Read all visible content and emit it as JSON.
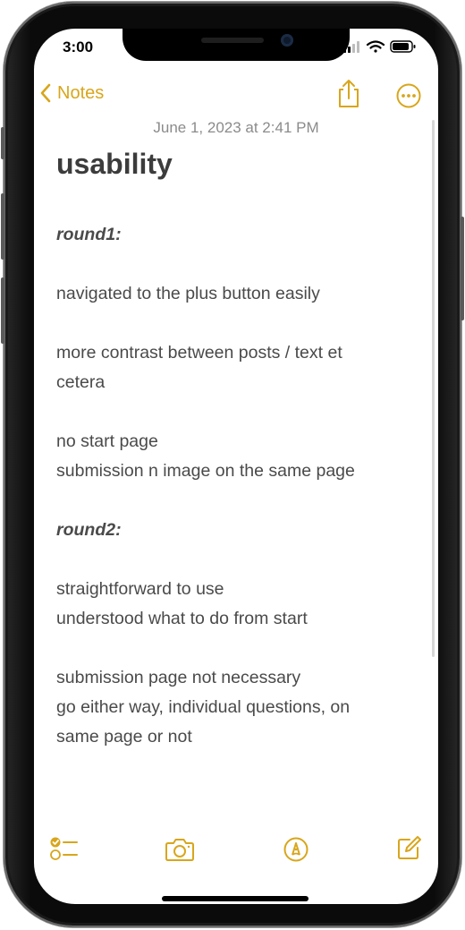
{
  "status_bar": {
    "time": "3:00"
  },
  "nav": {
    "back_label": "Notes"
  },
  "note": {
    "date": "June 1, 2023 at 2:41 PM",
    "title": "usability",
    "lines": [
      {
        "type": "heading",
        "text": "round1:"
      },
      {
        "type": "gap",
        "text": ""
      },
      {
        "type": "text",
        "text": "navigated to the plus button easily"
      },
      {
        "type": "gap",
        "text": ""
      },
      {
        "type": "text",
        "text": "more contrast between posts / text et"
      },
      {
        "type": "text",
        "text": "cetera"
      },
      {
        "type": "gap",
        "text": ""
      },
      {
        "type": "text",
        "text": "no start page"
      },
      {
        "type": "text",
        "text": "submission n image on the same page"
      },
      {
        "type": "gap",
        "text": ""
      },
      {
        "type": "heading",
        "text": "round2:"
      },
      {
        "type": "gap",
        "text": ""
      },
      {
        "type": "text",
        "text": "straightforward to use"
      },
      {
        "type": "text",
        "text": "understood what to do from start"
      },
      {
        "type": "gap",
        "text": ""
      },
      {
        "type": "text",
        "text": "submission page not necessary"
      },
      {
        "type": "text",
        "text": "go either way, individual questions, on"
      },
      {
        "type": "text",
        "text": "same page or not"
      }
    ]
  },
  "icons": {
    "back": "chevron-left-icon",
    "share": "share-icon",
    "more": "ellipsis-circle-icon",
    "checklist": "checklist-icon",
    "camera": "camera-icon",
    "markup": "markup-pen-icon",
    "compose": "compose-icon"
  },
  "colors": {
    "accent": "#d8a61c",
    "text": "#4a4a4a",
    "date": "#8b8b8b"
  }
}
